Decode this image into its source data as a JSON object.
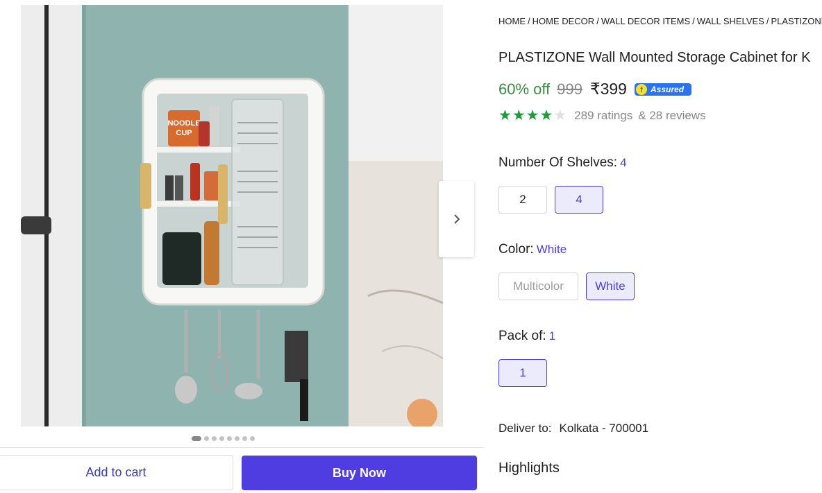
{
  "breadcrumb": [
    "HOME",
    "HOME DECOR",
    "WALL DECOR ITEMS",
    "WALL SHELVES",
    "PLASTIZONE W"
  ],
  "product": {
    "title": "PLASTIZONE Wall Mounted Storage Cabinet for K",
    "discount": "60% off",
    "mrp": "999",
    "price": "₹399",
    "assured_label": "Assured",
    "rating_value": 4,
    "ratings_text": "289 ratings",
    "reviews_text": "& 28 reviews"
  },
  "options": {
    "shelves": {
      "label": "Number Of Shelves:",
      "selected": "4",
      "choices": [
        "2",
        "4"
      ]
    },
    "color": {
      "label": "Color:",
      "selected": "White",
      "choices": [
        "Multicolor",
        "White"
      ]
    },
    "pack": {
      "label": "Pack of:",
      "selected": "1",
      "choices": [
        "1"
      ]
    }
  },
  "delivery": {
    "label": "Deliver to:",
    "location": "Kolkata - 700001"
  },
  "highlights_heading": "Highlights",
  "image_label": {
    "line1": "NOODLE",
    "line2": "CUP"
  },
  "gallery": {
    "image_count": 8,
    "active_index": 0
  },
  "actions": {
    "add_to_cart": "Add to cart",
    "buy_now": "Buy Now"
  },
  "colors": {
    "brand": "#4f3de2",
    "discount_green": "#388e3c",
    "star_green": "#1a9d3a",
    "assured_blue": "#2874f0"
  }
}
